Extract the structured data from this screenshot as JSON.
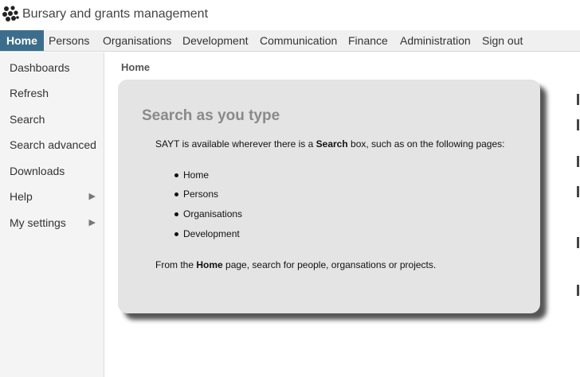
{
  "app": {
    "title": "Bursary and grants management"
  },
  "menubar": {
    "items": [
      {
        "label": "Home",
        "active": true
      },
      {
        "label": "Persons"
      },
      {
        "label": "Organisations"
      },
      {
        "label": "Development"
      },
      {
        "label": "Communication"
      },
      {
        "label": "Finance"
      },
      {
        "label": "Administration"
      },
      {
        "label": "Sign out"
      }
    ],
    "active_color": "#3c6e8c"
  },
  "sidebar": {
    "items": [
      {
        "label": "Dashboards"
      },
      {
        "label": "Refresh"
      },
      {
        "label": "Search"
      },
      {
        "label": "Search advanced"
      },
      {
        "label": "Downloads"
      },
      {
        "label": "Help",
        "submenu": true,
        "arrow": "▶"
      },
      {
        "label": "My settings",
        "submenu": true,
        "arrow": "▶"
      }
    ]
  },
  "breadcrumb": "Home",
  "card": {
    "title": "Search as you type",
    "intro_pre": "SAYT is available wherever there is a ",
    "intro_bold": "Search",
    "intro_post": " box, such as on the following pages:",
    "bullets": [
      "Home",
      "Persons",
      "Organisations",
      "Development"
    ],
    "outro_pre": "From the ",
    "outro_bold": "Home",
    "outro_post": " page, search for people, organsations or projects."
  },
  "icons": {
    "logo": "bursary-logo-icon",
    "submenu": "triangle-right-icon"
  }
}
